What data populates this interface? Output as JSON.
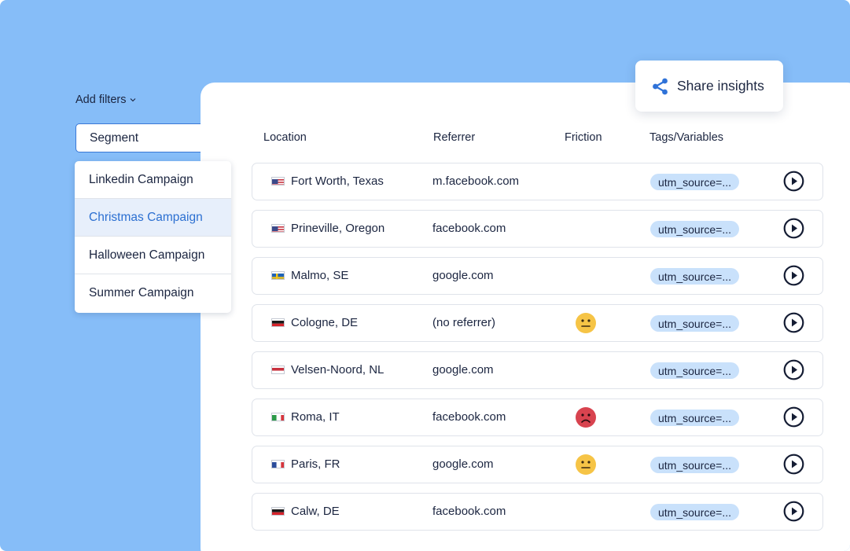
{
  "filters": {
    "add_filters_label": "Add filters",
    "segment_label": "Segment",
    "segment_options": [
      {
        "label": "Linkedin Campaign",
        "selected": false
      },
      {
        "label": "Christmas Campaign",
        "selected": true
      },
      {
        "label": "Halloween Campaign",
        "selected": false
      },
      {
        "label": "Summer Campaign",
        "selected": false
      }
    ]
  },
  "share": {
    "label": "Share insights",
    "icon": "share-icon",
    "icon_color": "#2f72d8"
  },
  "table": {
    "columns": [
      "Location",
      "Referrer",
      "Friction",
      "Tags/Variables"
    ],
    "rows": [
      {
        "flag": "us",
        "location": "Fort Worth, Texas",
        "referrer": "m.facebook.com",
        "friction": null,
        "tag": "utm_source=..."
      },
      {
        "flag": "us",
        "location": "Prineville, Oregon",
        "referrer": "facebook.com",
        "friction": null,
        "tag": "utm_source=..."
      },
      {
        "flag": "se",
        "location": "Malmo, SE",
        "referrer": "google.com",
        "friction": null,
        "tag": "utm_source=..."
      },
      {
        "flag": "de",
        "location": "Cologne, DE",
        "referrer": "(no referrer)",
        "friction": "neutral",
        "tag": "utm_source=..."
      },
      {
        "flag": "nl",
        "location": "Velsen-Noord, NL",
        "referrer": "google.com",
        "friction": null,
        "tag": "utm_source=..."
      },
      {
        "flag": "it",
        "location": "Roma, IT",
        "referrer": "facebook.com",
        "friction": "frustrated",
        "tag": "utm_source=..."
      },
      {
        "flag": "fr",
        "location": "Paris, FR",
        "referrer": "google.com",
        "friction": "neutral",
        "tag": "utm_source=..."
      },
      {
        "flag": "de",
        "location": "Calw, DE",
        "referrer": "facebook.com",
        "friction": null,
        "tag": "utm_source=..."
      }
    ]
  },
  "colors": {
    "background": "#86bdf8",
    "accent": "#2b6fd1",
    "tag_bg": "#c9e1fb",
    "neutral_face": "#f6c446",
    "frustrated_face": "#d8434f"
  }
}
